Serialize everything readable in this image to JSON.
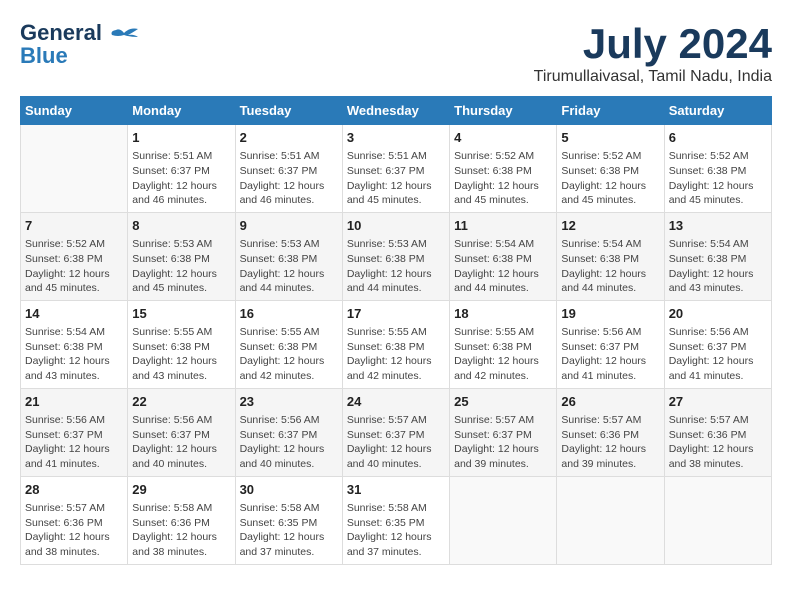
{
  "header": {
    "logo_line1": "General",
    "logo_line2": "Blue",
    "month_title": "July 2024",
    "location": "Tirumullaivasal, Tamil Nadu, India"
  },
  "weekdays": [
    "Sunday",
    "Monday",
    "Tuesday",
    "Wednesday",
    "Thursday",
    "Friday",
    "Saturday"
  ],
  "weeks": [
    [
      {
        "day": "",
        "info": ""
      },
      {
        "day": "1",
        "info": "Sunrise: 5:51 AM\nSunset: 6:37 PM\nDaylight: 12 hours\nand 46 minutes."
      },
      {
        "day": "2",
        "info": "Sunrise: 5:51 AM\nSunset: 6:37 PM\nDaylight: 12 hours\nand 46 minutes."
      },
      {
        "day": "3",
        "info": "Sunrise: 5:51 AM\nSunset: 6:37 PM\nDaylight: 12 hours\nand 45 minutes."
      },
      {
        "day": "4",
        "info": "Sunrise: 5:52 AM\nSunset: 6:38 PM\nDaylight: 12 hours\nand 45 minutes."
      },
      {
        "day": "5",
        "info": "Sunrise: 5:52 AM\nSunset: 6:38 PM\nDaylight: 12 hours\nand 45 minutes."
      },
      {
        "day": "6",
        "info": "Sunrise: 5:52 AM\nSunset: 6:38 PM\nDaylight: 12 hours\nand 45 minutes."
      }
    ],
    [
      {
        "day": "7",
        "info": "Sunrise: 5:52 AM\nSunset: 6:38 PM\nDaylight: 12 hours\nand 45 minutes."
      },
      {
        "day": "8",
        "info": "Sunrise: 5:53 AM\nSunset: 6:38 PM\nDaylight: 12 hours\nand 45 minutes."
      },
      {
        "day": "9",
        "info": "Sunrise: 5:53 AM\nSunset: 6:38 PM\nDaylight: 12 hours\nand 44 minutes."
      },
      {
        "day": "10",
        "info": "Sunrise: 5:53 AM\nSunset: 6:38 PM\nDaylight: 12 hours\nand 44 minutes."
      },
      {
        "day": "11",
        "info": "Sunrise: 5:54 AM\nSunset: 6:38 PM\nDaylight: 12 hours\nand 44 minutes."
      },
      {
        "day": "12",
        "info": "Sunrise: 5:54 AM\nSunset: 6:38 PM\nDaylight: 12 hours\nand 44 minutes."
      },
      {
        "day": "13",
        "info": "Sunrise: 5:54 AM\nSunset: 6:38 PM\nDaylight: 12 hours\nand 43 minutes."
      }
    ],
    [
      {
        "day": "14",
        "info": "Sunrise: 5:54 AM\nSunset: 6:38 PM\nDaylight: 12 hours\nand 43 minutes."
      },
      {
        "day": "15",
        "info": "Sunrise: 5:55 AM\nSunset: 6:38 PM\nDaylight: 12 hours\nand 43 minutes."
      },
      {
        "day": "16",
        "info": "Sunrise: 5:55 AM\nSunset: 6:38 PM\nDaylight: 12 hours\nand 42 minutes."
      },
      {
        "day": "17",
        "info": "Sunrise: 5:55 AM\nSunset: 6:38 PM\nDaylight: 12 hours\nand 42 minutes."
      },
      {
        "day": "18",
        "info": "Sunrise: 5:55 AM\nSunset: 6:38 PM\nDaylight: 12 hours\nand 42 minutes."
      },
      {
        "day": "19",
        "info": "Sunrise: 5:56 AM\nSunset: 6:37 PM\nDaylight: 12 hours\nand 41 minutes."
      },
      {
        "day": "20",
        "info": "Sunrise: 5:56 AM\nSunset: 6:37 PM\nDaylight: 12 hours\nand 41 minutes."
      }
    ],
    [
      {
        "day": "21",
        "info": "Sunrise: 5:56 AM\nSunset: 6:37 PM\nDaylight: 12 hours\nand 41 minutes."
      },
      {
        "day": "22",
        "info": "Sunrise: 5:56 AM\nSunset: 6:37 PM\nDaylight: 12 hours\nand 40 minutes."
      },
      {
        "day": "23",
        "info": "Sunrise: 5:56 AM\nSunset: 6:37 PM\nDaylight: 12 hours\nand 40 minutes."
      },
      {
        "day": "24",
        "info": "Sunrise: 5:57 AM\nSunset: 6:37 PM\nDaylight: 12 hours\nand 40 minutes."
      },
      {
        "day": "25",
        "info": "Sunrise: 5:57 AM\nSunset: 6:37 PM\nDaylight: 12 hours\nand 39 minutes."
      },
      {
        "day": "26",
        "info": "Sunrise: 5:57 AM\nSunset: 6:36 PM\nDaylight: 12 hours\nand 39 minutes."
      },
      {
        "day": "27",
        "info": "Sunrise: 5:57 AM\nSunset: 6:36 PM\nDaylight: 12 hours\nand 38 minutes."
      }
    ],
    [
      {
        "day": "28",
        "info": "Sunrise: 5:57 AM\nSunset: 6:36 PM\nDaylight: 12 hours\nand 38 minutes."
      },
      {
        "day": "29",
        "info": "Sunrise: 5:58 AM\nSunset: 6:36 PM\nDaylight: 12 hours\nand 38 minutes."
      },
      {
        "day": "30",
        "info": "Sunrise: 5:58 AM\nSunset: 6:35 PM\nDaylight: 12 hours\nand 37 minutes."
      },
      {
        "day": "31",
        "info": "Sunrise: 5:58 AM\nSunset: 6:35 PM\nDaylight: 12 hours\nand 37 minutes."
      },
      {
        "day": "",
        "info": ""
      },
      {
        "day": "",
        "info": ""
      },
      {
        "day": "",
        "info": ""
      }
    ]
  ]
}
